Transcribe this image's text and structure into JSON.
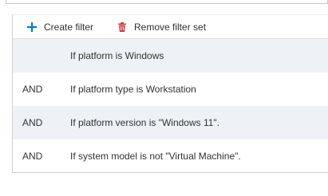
{
  "toolbar": {
    "create_filter_label": "Create filter",
    "remove_filter_set_label": "Remove filter set",
    "create_icon": "plus-icon",
    "remove_icon": "trash-icon",
    "accent_color": "#0078d4",
    "delete_color": "#d13438"
  },
  "filters": [
    {
      "operator": "",
      "condition": "If platform is Windows"
    },
    {
      "operator": "AND",
      "condition": "If platform type is Workstation"
    },
    {
      "operator": "AND",
      "condition": "If platform version is \"Windows 11\"."
    },
    {
      "operator": "AND",
      "condition": "If system model is not \"Virtual Machine\"."
    }
  ]
}
